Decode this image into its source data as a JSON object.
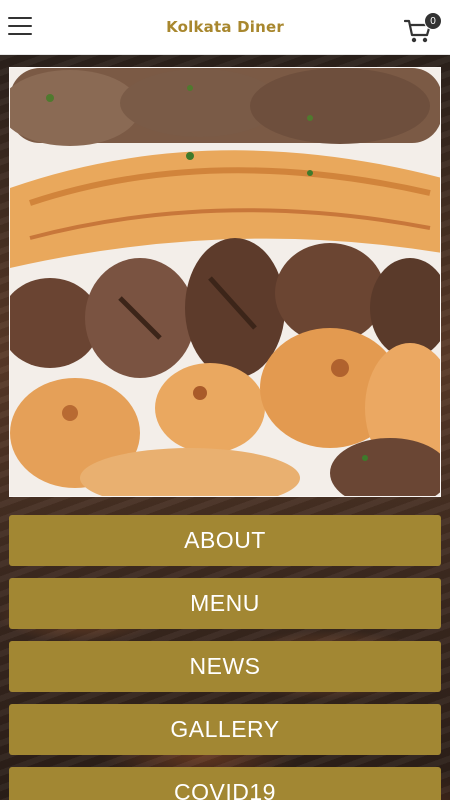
{
  "header": {
    "title": "Kolkata Diner",
    "cart_count": "0"
  },
  "hero": {
    "slide_count_visible": 1,
    "active_slide": 1
  },
  "nav": [
    {
      "label": "ABOUT"
    },
    {
      "label": "MENU"
    },
    {
      "label": "NEWS"
    },
    {
      "label": "GALLERY"
    },
    {
      "label": "COVID19"
    }
  ],
  "colors": {
    "accent": "#a28733",
    "title": "#a8872e",
    "header_bg": "#ffffff"
  }
}
